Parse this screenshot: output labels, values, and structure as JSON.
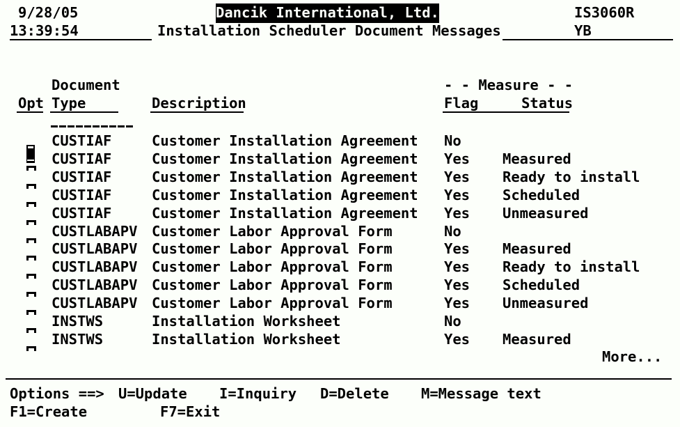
{
  "app": {
    "terminal_type": "as400-green-screen",
    "background_color": "#fcfffa",
    "foreground_color": "#000000"
  },
  "header": {
    "date": "9/28/05",
    "time": "13:39:54",
    "company_title": "Dancik International, Ltd.",
    "screen_title": "Installation Scheduler Document Messages",
    "program_id": "IS3060R",
    "user_code": "YB"
  },
  "columns": {
    "opt": "Opt",
    "document": "Document",
    "type": "Type",
    "description": "Description",
    "measure_group": "- - Measure - -",
    "flag": "Flag",
    "status": "Status",
    "flag_status_header": "Flag     Status"
  },
  "rows": [
    {
      "opt": "",
      "type": "CUSTIAF",
      "description": "Customer Installation Agreement",
      "flag": "No",
      "status": ""
    },
    {
      "opt": "",
      "type": "CUSTIAF",
      "description": "Customer Installation Agreement",
      "flag": "Yes",
      "status": "Measured"
    },
    {
      "opt": "",
      "type": "CUSTIAF",
      "description": "Customer Installation Agreement",
      "flag": "Yes",
      "status": "Ready to install"
    },
    {
      "opt": "",
      "type": "CUSTIAF",
      "description": "Customer Installation Agreement",
      "flag": "Yes",
      "status": "Scheduled"
    },
    {
      "opt": "",
      "type": "CUSTIAF",
      "description": "Customer Installation Agreement",
      "flag": "Yes",
      "status": "Unmeasured"
    },
    {
      "opt": "",
      "type": "CUSTLABAPV",
      "description": "Customer Labor Approval Form",
      "flag": "No",
      "status": ""
    },
    {
      "opt": "",
      "type": "CUSTLABAPV",
      "description": "Customer Labor Approval Form",
      "flag": "Yes",
      "status": "Measured"
    },
    {
      "opt": "",
      "type": "CUSTLABAPV",
      "description": "Customer Labor Approval Form",
      "flag": "Yes",
      "status": "Ready to install"
    },
    {
      "opt": "",
      "type": "CUSTLABAPV",
      "description": "Customer Labor Approval Form",
      "flag": "Yes",
      "status": "Scheduled"
    },
    {
      "opt": "",
      "type": "CUSTLABAPV",
      "description": "Customer Labor Approval Form",
      "flag": "Yes",
      "status": "Unmeasured"
    },
    {
      "opt": "",
      "type": "INSTWS",
      "description": "Installation Worksheet",
      "flag": "No",
      "status": ""
    },
    {
      "opt": "",
      "type": "INSTWS",
      "description": "Installation Worksheet",
      "flag": "Yes",
      "status": "Measured"
    }
  ],
  "paging": {
    "more": "More..."
  },
  "footer": {
    "options_prompt": "Options ==>",
    "option_update": "U=Update",
    "option_inquiry": "I=Inquiry",
    "option_delete": "D=Delete",
    "option_message": "M=Message text",
    "fkey_create": "F1=Create",
    "fkey_exit": "F7=Exit"
  }
}
